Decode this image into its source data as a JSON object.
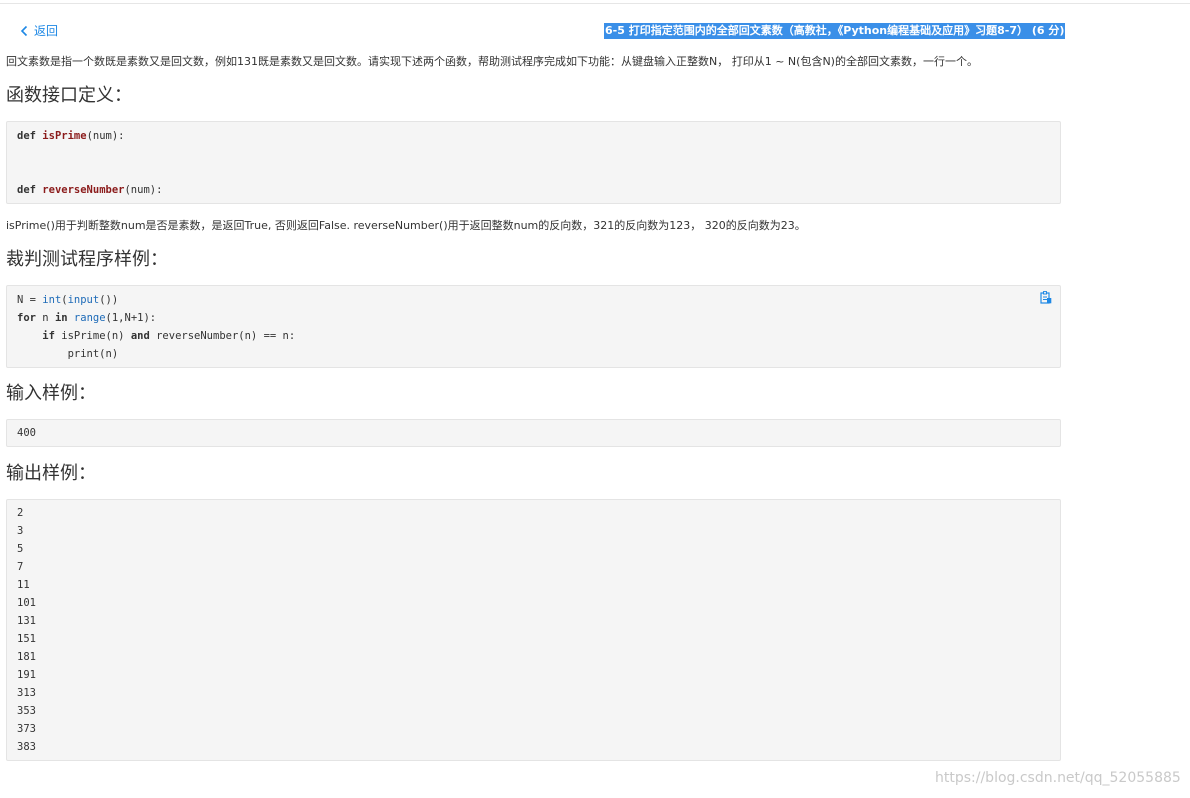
{
  "nav": {
    "back_label": "返回"
  },
  "problem": {
    "title": "6-5 打印指定范围内的全部回文素数（高教社，《Python编程基础及应用》习题8-7） (6 分)",
    "description": "回文素数是指一个数既是素数又是回文数，例如131既是素数又是回文数。请实现下述两个函数，帮助测试程序完成如下功能：从键盘输入正整数N， 打印从1 ~ N(包含N)的全部回文素数，一行一个。"
  },
  "sections": {
    "interface_heading": "函数接口定义：",
    "interface_code": {
      "line1": {
        "kw": "def",
        "name": "isPrime",
        "args": "(num):"
      },
      "line2": {
        "kw": "def",
        "name": "reverseNumber",
        "args": "(num):"
      }
    },
    "interface_note": "isPrime()用于判断整数num是否是素数，是返回True, 否则返回False. reverseNumber()用于返回整数num的反向数，321的反向数为123， 320的反向数为23。",
    "test_heading": "裁判测试程序样例：",
    "test_code": {
      "l1_a": "N = ",
      "l1_b": "int",
      "l1_c": "(",
      "l1_d": "input",
      "l1_e": "())",
      "l2_a": "for",
      "l2_b": " n ",
      "l2_c": "in",
      "l2_d": " ",
      "l2_e": "range",
      "l2_f": "(1,N+1):",
      "l3_a": "    ",
      "l3_b": "if",
      "l3_c": " isPrime(n) ",
      "l3_d": "and",
      "l3_e": " reverseNumber(n) == n:",
      "l4": "        print(n)"
    },
    "input_heading": "输入样例：",
    "input_sample": "400",
    "output_heading": "输出样例：",
    "output_sample": [
      "2",
      "3",
      "5",
      "7",
      "11",
      "101",
      "131",
      "151",
      "181",
      "191",
      "313",
      "353",
      "373",
      "383"
    ]
  },
  "watermark": "https://blog.csdn.net/qq_52055885",
  "icons": {
    "back": "chevron-left-icon",
    "copy": "copy-icon"
  },
  "colors": {
    "link": "#1e88e5",
    "title_highlight": "#3a8fe8",
    "code_bg": "#f5f5f5",
    "function_name": "#8b1b1b",
    "builtin": "#1e6bb8"
  }
}
